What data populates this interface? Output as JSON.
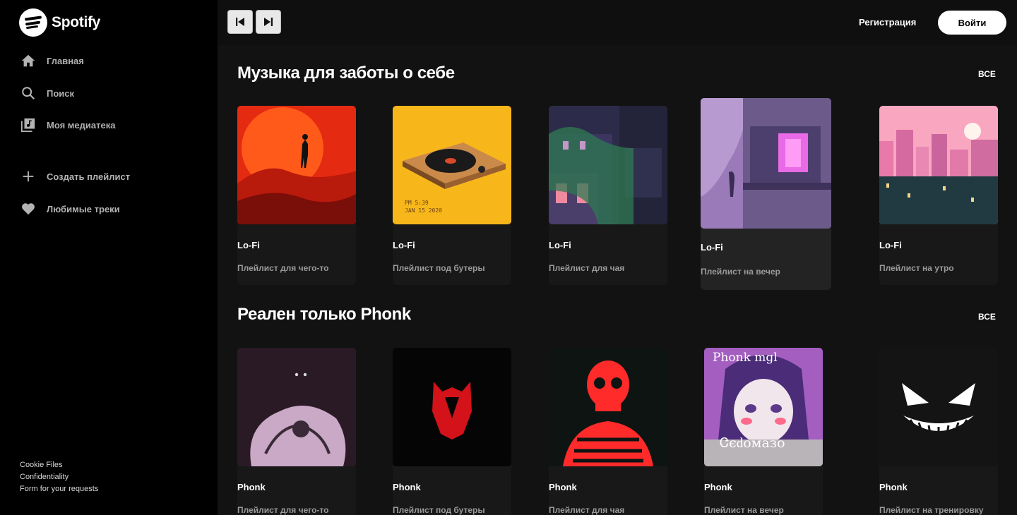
{
  "app": {
    "name": "Spotify"
  },
  "sidebar": {
    "items": [
      {
        "label": "Главная",
        "icon": "home-icon"
      },
      {
        "label": "Поиск",
        "icon": "search-icon"
      },
      {
        "label": "Моя медиатека",
        "icon": "library-icon"
      },
      {
        "label": "Создать плейлист",
        "icon": "plus-icon"
      },
      {
        "label": "Любимые треки",
        "icon": "heart-icon"
      }
    ],
    "footer": [
      "Cookie Files",
      "Confidentiality",
      "Form for your requests"
    ]
  },
  "topbar": {
    "prev_icon": "skip-back-icon",
    "next_icon": "skip-forward-icon",
    "register": "Регистрация",
    "login": "Войти"
  },
  "sections": [
    {
      "title": "Музыка для заботы о себе",
      "see_all": "ВСЕ",
      "cards": [
        {
          "title": "Lo-Fi",
          "subtitle": "Плейлист для чего-то"
        },
        {
          "title": "Lo-Fi",
          "subtitle": "Плейлист под бутеры",
          "cover_text": [
            "PM 5:39",
            "JAN 15 2020"
          ]
        },
        {
          "title": "Lo-Fi",
          "subtitle": "Плейлист для чая"
        },
        {
          "title": "Lo-Fi",
          "subtitle": "Плейлист на вечер"
        },
        {
          "title": "Lo-Fi",
          "subtitle": "Плейлист на утро"
        }
      ]
    },
    {
      "title": "Реален только Phonk",
      "see_all": "ВСЕ",
      "cards": [
        {
          "title": "Phonk",
          "subtitle": "Плейлист для чего-то"
        },
        {
          "title": "Phonk",
          "subtitle": "Плейлист под бутеры"
        },
        {
          "title": "Phonk",
          "subtitle": "Плейлист для чая"
        },
        {
          "title": "Phonk",
          "subtitle": "Плейлист на вечер",
          "cover_text": [
            "Phonk mgl",
            "Ꮳєԁомазо"
          ]
        },
        {
          "title": "Phonk",
          "subtitle": "Плейлист на тренировку"
        }
      ]
    }
  ],
  "colors": {
    "background": "#121212",
    "sidebar": "#000000",
    "card": "#181818",
    "accent": "#ffffff"
  }
}
